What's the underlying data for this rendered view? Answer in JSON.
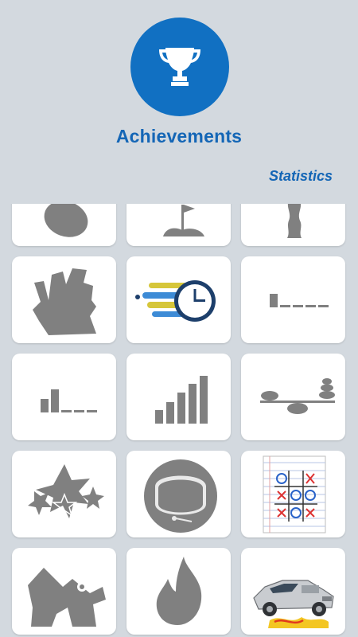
{
  "header": {
    "title": "Achievements",
    "trophy_icon": "trophy-icon",
    "accent_color": "#1170c2"
  },
  "statistics_link": "Statistics",
  "achievements": [
    {
      "icon": "potato-icon",
      "unlocked": false
    },
    {
      "icon": "flag-mound-icon",
      "unlocked": false
    },
    {
      "icon": "cactus-icon",
      "unlocked": false
    },
    {
      "icon": "rock-climber-icon",
      "unlocked": false
    },
    {
      "icon": "fast-clock-icon",
      "unlocked": true
    },
    {
      "icon": "progress-one-bar-icon",
      "unlocked": false
    },
    {
      "icon": "progress-two-bars-icon",
      "unlocked": false
    },
    {
      "icon": "progress-bars-full-icon",
      "unlocked": false
    },
    {
      "icon": "balance-stones-icon",
      "unlocked": false
    },
    {
      "icon": "stars-icon",
      "unlocked": false
    },
    {
      "icon": "astronaut-helmet-icon",
      "unlocked": false
    },
    {
      "icon": "tic-tac-toe-icon",
      "unlocked": true
    },
    {
      "icon": "broken-arm-icon",
      "unlocked": false
    },
    {
      "icon": "flame-icon",
      "unlocked": false
    },
    {
      "icon": "time-machine-car-icon",
      "unlocked": true
    }
  ]
}
